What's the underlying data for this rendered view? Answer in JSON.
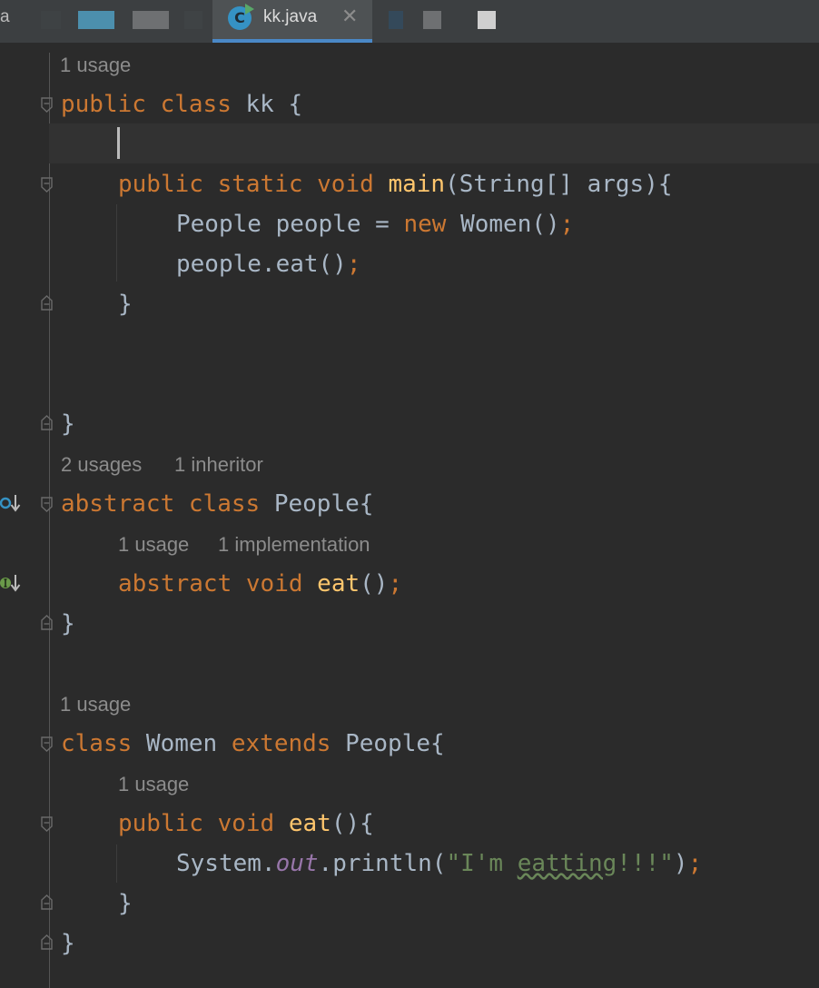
{
  "tabs": {
    "left_fragment": "a",
    "active_label": "kk.java",
    "active_icon_letter": "C",
    "close_glyph": "✕"
  },
  "editor": {
    "hints": {
      "kk": "1 usage",
      "people_usages": "2 usages",
      "people_inheritors": "1 inheritor",
      "eat_usages": "1 usage",
      "eat_implementations": "1 implementation",
      "women": "1 usage",
      "women_eat": "1 usage"
    },
    "tokens": {
      "public": "public",
      "class": "class",
      "static": "static",
      "void": "void",
      "new": "new",
      "abstract": "abstract",
      "extends": "extends",
      "kk_decl": " kk {",
      "main": "main",
      "main_params": "(String[] args){",
      "people_decl": "People people = ",
      "women_ctor": " Women()",
      "semi": ";",
      "people_eat": "people.eat()",
      "close_brace": "}",
      "people_class": " People{",
      "eat": "eat",
      "eat_parens": "()",
      "women_class": " Women ",
      "people_super": " People{",
      "eat_open": "(){",
      "system": "System.",
      "out": "out",
      "println_open": ".println(",
      "str_start": "\"I'm ",
      "str_typo": "eatting",
      "str_end": "!!!\"",
      "println_close": ")"
    }
  },
  "colors": {
    "background": "#2b2b2b",
    "keyword": "#cc7832",
    "function": "#ffc66d",
    "string": "#6a8759",
    "field": "#9876aa",
    "text": "#a9b7c6",
    "hint": "#8c8c8c",
    "tab_accent": "#4a88c7"
  },
  "gutter_icons": {
    "people": "overridden-down-arrow-icon",
    "eat": "implemented-down-arrow-icon"
  }
}
